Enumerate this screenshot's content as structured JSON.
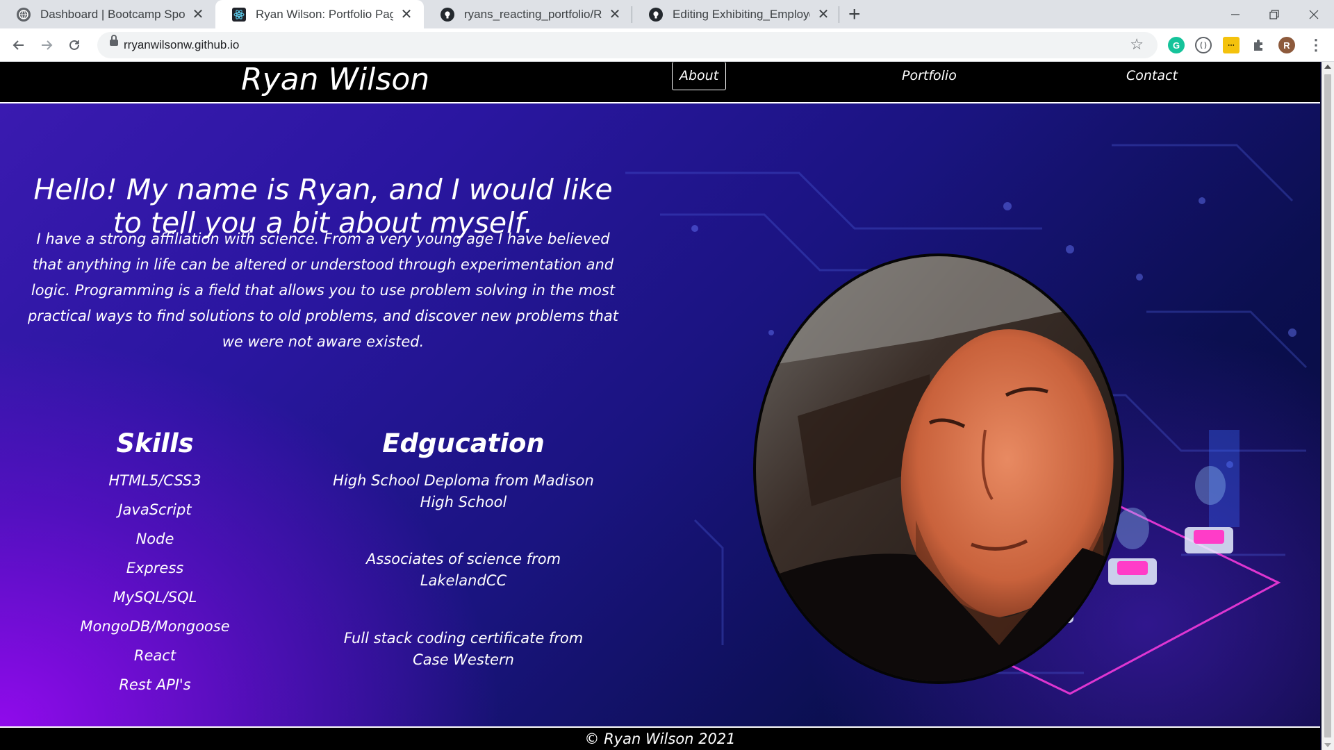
{
  "browser": {
    "tabs": [
      {
        "title": "Dashboard | Bootcamp Spot",
        "close": "✕"
      },
      {
        "title": "Ryan Wilson: Portfolio Page",
        "close": "✕"
      },
      {
        "title": "ryans_reacting_portfolio/READM",
        "close": "✕"
      },
      {
        "title": "Editing Exhibiting_Employees/RE",
        "close": "✕"
      }
    ],
    "new_tab_label": "+",
    "url": "rryanwilsonw.github.io",
    "profile_initial": "R",
    "icons": [
      "back-arrow-icon",
      "forward-arrow-icon",
      "reload-icon",
      "lock-icon",
      "star-icon",
      "grammarly-icon",
      "extension-puzzle-icon",
      "menu-dots-icon"
    ]
  },
  "site": {
    "brand": "Ryan Wilson",
    "nav": [
      {
        "label": "About",
        "active": true
      },
      {
        "label": "Portfolio",
        "active": false
      },
      {
        "label": "Contact",
        "active": false
      }
    ],
    "intro_heading": "Hello! My name is Ryan, and I would like to tell you a bit about myself.",
    "intro_text": "I have a strong affiliation with science. From a very young age I have believed that anything in life can be altered or understood through experimentation and logic. Programming is a field that allows you to use problem solving in the most practical ways to find solutions to old problems, and discover new problems that we were not aware existed.",
    "skills_title": "Skills",
    "skills": [
      "HTML5/CSS3",
      "JavaScript",
      "Node",
      "Express",
      "MySQL/SQL",
      "MongoDB/Mongoose",
      "React",
      "Rest API's"
    ],
    "education_title": "Edgucation",
    "education": [
      "High School Deploma from Madison High School",
      "Associates of science from LakelandCC",
      "Full stack coding certificate from Case Western"
    ],
    "footer": "© Ryan Wilson 2021"
  }
}
